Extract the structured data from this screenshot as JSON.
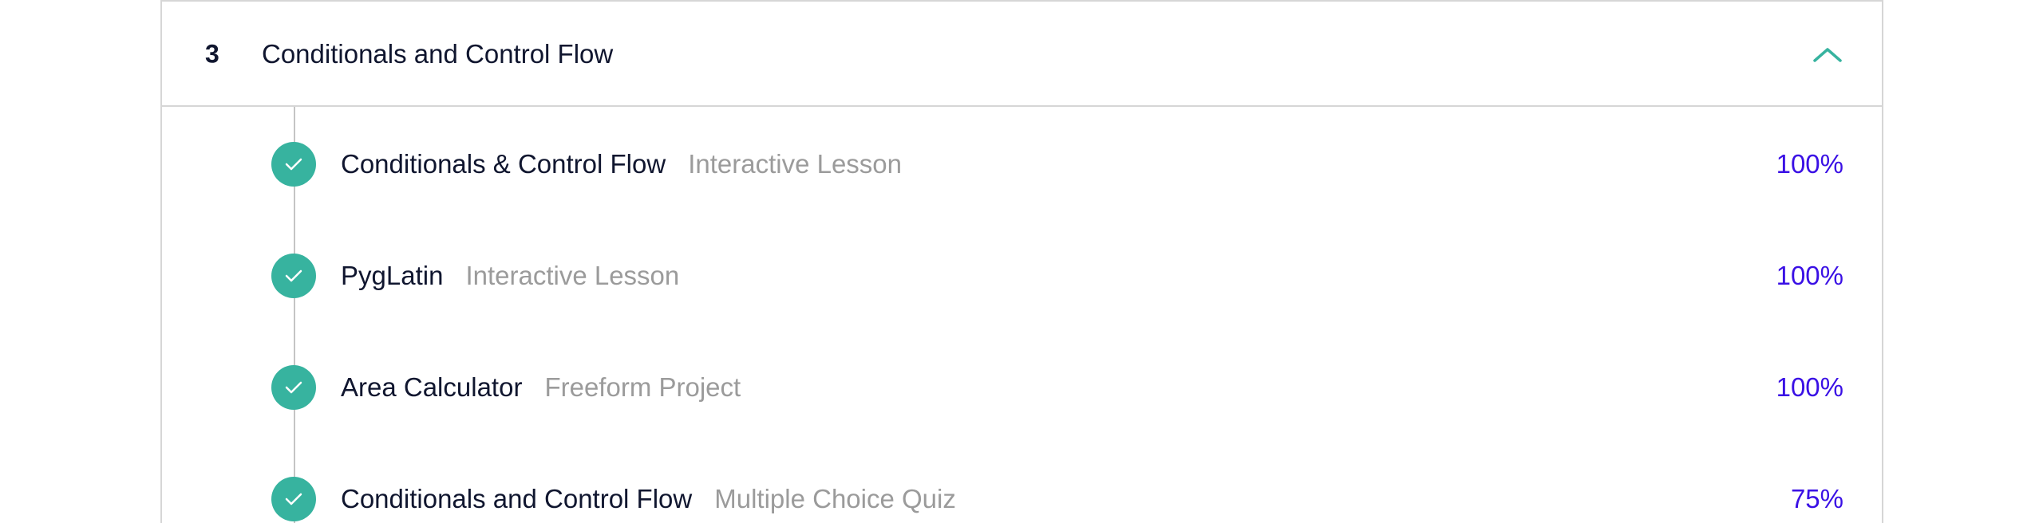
{
  "module": {
    "number": "3",
    "title": "Conditionals and Control Flow",
    "expanded": true,
    "collapse_icon": "chevron-up-icon",
    "accent_color": "#37b39f"
  },
  "lessons": [
    {
      "title": "Conditionals & Control Flow",
      "type": "Interactive Lesson",
      "progress": "100%",
      "completed": true,
      "status_icon": "check-icon"
    },
    {
      "title": "PygLatin",
      "type": "Interactive Lesson",
      "progress": "100%",
      "completed": true,
      "status_icon": "check-icon"
    },
    {
      "title": "Area Calculator",
      "type": "Freeform Project",
      "progress": "100%",
      "completed": true,
      "status_icon": "check-icon"
    },
    {
      "title": "Conditionals and Control Flow",
      "type": "Multiple Choice Quiz",
      "progress": "75%",
      "completed": true,
      "status_icon": "check-icon"
    }
  ],
  "colors": {
    "check_badge": "#37b39f",
    "progress_text": "#3a10e5",
    "title_text": "#10162f",
    "type_text": "#9b9b9b",
    "border": "#d6d6d6"
  }
}
